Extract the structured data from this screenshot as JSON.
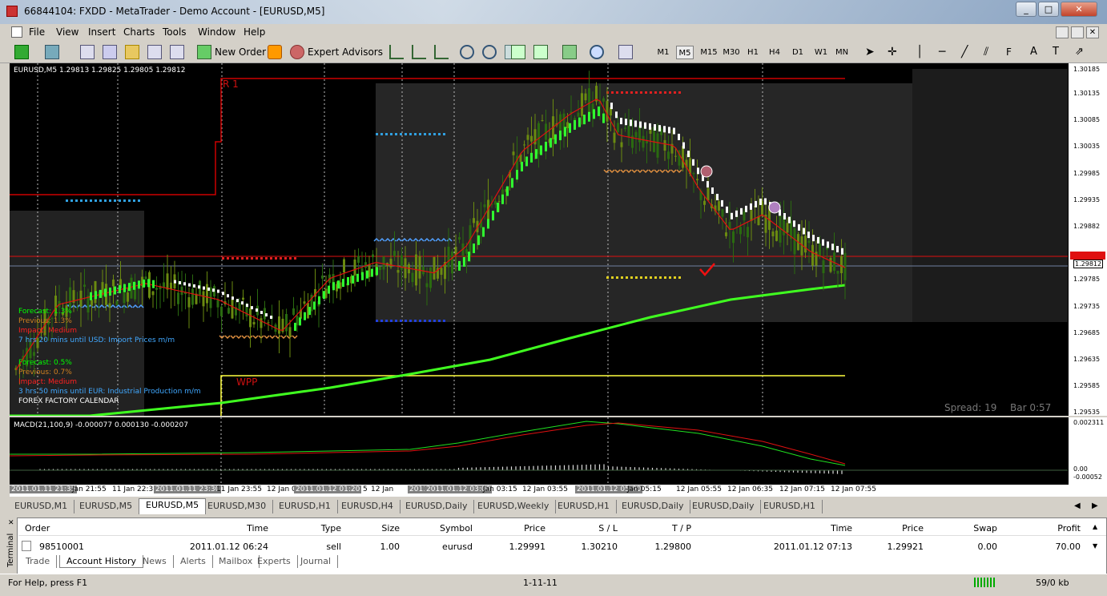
{
  "window": {
    "title": "66844104: FXDD - MetaTrader - Demo Account - [EURUSD,M5]"
  },
  "menu": [
    "File",
    "View",
    "Insert",
    "Charts",
    "Tools",
    "Window",
    "Help"
  ],
  "toolbar": {
    "new_order": "New Order",
    "expert_advisors": "Expert Advisors",
    "timeframes": [
      "M1",
      "M5",
      "M15",
      "M30",
      "H1",
      "H4",
      "D1",
      "W1",
      "MN"
    ],
    "active_timeframe": "M5",
    "text_tool": "A"
  },
  "chart": {
    "header": "EURUSD,M5  1.29813 1.29825 1.29805 1.29812",
    "r1_label": "R 1",
    "wpp_label": "WPP",
    "spread": "Spread: 19",
    "bar": "Bar  0:57",
    "info1": {
      "forecast": "Forecast: 1.3%",
      "previous": "Previous: 1.3%",
      "impact": "Impact: Medium",
      "until": "7 hrs 20 mins until USD: Import Prices m/m"
    },
    "info2": {
      "forecast": "Forecast: 0.5%",
      "previous": "Previous: 0.7%",
      "impact": "Impact: Medium",
      "until": "3 hrs 50 mins until EUR: Industrial Production m/m"
    },
    "calendar": "FOREX FACTORY CALENDAR",
    "price_axis": [
      "1.30185",
      "1.30135",
      "1.30085",
      "1.30035",
      "1.29985",
      "1.29935",
      "1.29882",
      "1.29812",
      "1.29785",
      "1.29735",
      "1.29685",
      "1.29635",
      "1.29585",
      "1.29535"
    ],
    "current_price": "1.29812",
    "macd_header": "MACD(21,100,9) -0.000077 0.000130 -0.000207",
    "macd_axis": [
      "0.002311",
      "0.00",
      "-0.00052"
    ]
  },
  "time_axis": [
    {
      "label": "2011.01.11 21:35",
      "box": true
    },
    {
      "label": "Jan 21:55",
      "box": false
    },
    {
      "label": "11 Jan 22:3",
      "box": false
    },
    {
      "label": "2011.01.11 23:30",
      "box": true
    },
    {
      "label": "11 Jan 23:55",
      "box": false
    },
    {
      "label": "12 Jan 0",
      "box": false
    },
    {
      "label": "2011.01.12 01:20",
      "box": true
    },
    {
      "label": "5",
      "box": false
    },
    {
      "label": "12 Jan",
      "box": false
    },
    {
      "label": "2011.01.",
      "box": true
    },
    {
      "label": "2011.01.12 03:00",
      "box": true
    },
    {
      "label": "Jan 03:15",
      "box": false
    },
    {
      "label": "12 Jan 03:55",
      "box": false
    },
    {
      "label": "2011.01.12 05:00",
      "box": true
    },
    {
      "label": "Jan 05:15",
      "box": false
    },
    {
      "label": "12 Jan 05:55",
      "box": false
    },
    {
      "label": "12 Jan 06:35",
      "box": false
    },
    {
      "label": "12 Jan 07:15",
      "box": false
    },
    {
      "label": "12 Jan 07:55",
      "box": false
    }
  ],
  "chart_tabs": [
    "EURUSD,M1",
    "EURUSD,M5",
    "EURUSD,M5",
    "EURUSD,M30",
    "EURUSD,H1",
    "EURUSD,H4",
    "EURUSD,Daily",
    "EURUSD,Weekly",
    "EURUSD,H1",
    "EURUSD,Daily",
    "EURUSD,Daily",
    "EURUSD,H1"
  ],
  "active_chart_tab": 2,
  "terminal": {
    "side_label": "Terminal",
    "columns": [
      "Order",
      "Time",
      "Type",
      "Size",
      "Symbol",
      "Price",
      "S / L",
      "T / P",
      "Time",
      "Price",
      "Swap",
      "Profit"
    ],
    "row": [
      "98510001",
      "2011.01.12 06:24",
      "sell",
      "1.00",
      "eurusd",
      "1.29991",
      "1.30210",
      "1.29800",
      "2011.01.12 07:13",
      "1.29921",
      "0.00",
      "70.00"
    ],
    "tabs": [
      "Trade",
      "Account History",
      "News",
      "Alerts",
      "Mailbox",
      "Experts",
      "Journal"
    ],
    "active_tab": 1
  },
  "status": {
    "help": "For Help, press F1",
    "date": "1-11-11",
    "traffic": "59/0 kb"
  }
}
